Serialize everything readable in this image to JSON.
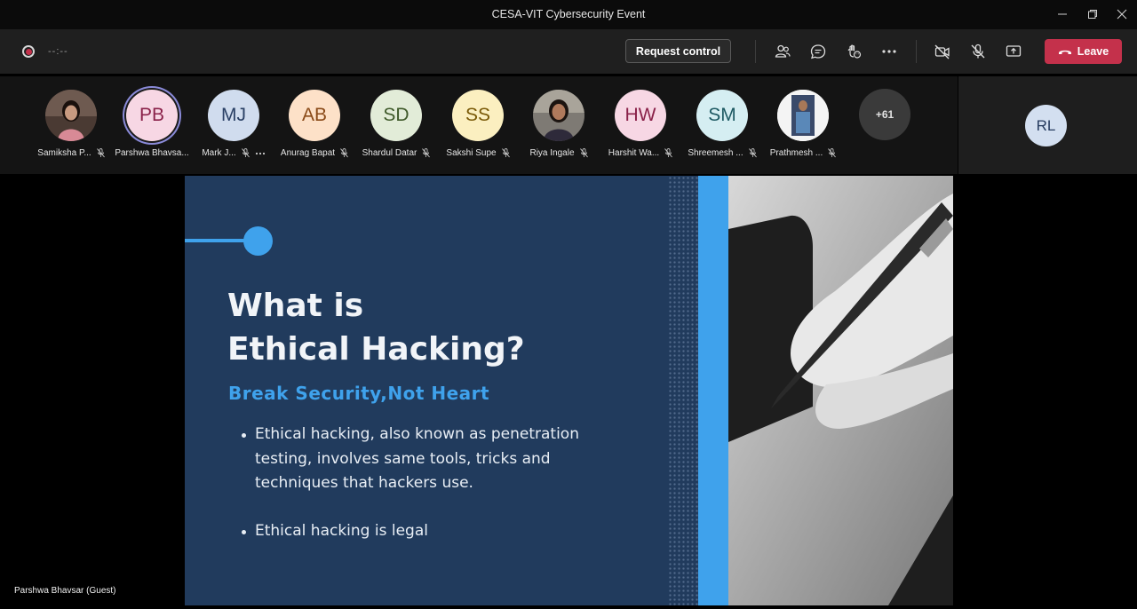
{
  "window": {
    "title": "CESA-VIT Cybersecurity Event"
  },
  "toolbar": {
    "timer": "--:--",
    "request_control_label": "Request control",
    "leave_label": "Leave",
    "colors": {
      "leave": "#c4314b",
      "recording": "#c4314b"
    }
  },
  "participants": [
    {
      "name": "Samiksha P...",
      "initials": "",
      "photo": true,
      "muted": true
    },
    {
      "name": "Parshwa Bhavsa...",
      "initials": "PB",
      "bg": "#f7d7e4",
      "fg": "#8a2149",
      "muted": false,
      "active": true
    },
    {
      "name": "Mark J...",
      "initials": "MJ",
      "bg": "#d0dcee",
      "fg": "#2b4166",
      "muted": true,
      "more": true
    },
    {
      "name": "Anurag Bapat",
      "initials": "AB",
      "bg": "#fde1c8",
      "fg": "#8a4a18",
      "muted": true
    },
    {
      "name": "Shardul Datar",
      "initials": "SD",
      "bg": "#e2ecd8",
      "fg": "#3f5a2a",
      "muted": true
    },
    {
      "name": "Sakshi Supe",
      "initials": "SS",
      "bg": "#fbefc0",
      "fg": "#7a5a08",
      "muted": true
    },
    {
      "name": "Riya Ingale",
      "initials": "",
      "photo": true,
      "muted": true
    },
    {
      "name": "Harshit Wa...",
      "initials": "HW",
      "bg": "#f7d7e4",
      "fg": "#8a2149",
      "muted": true
    },
    {
      "name": "Shreemesh ...",
      "initials": "SM",
      "bg": "#d5eef2",
      "fg": "#1e5a63",
      "muted": true
    },
    {
      "name": "Prathmesh ...",
      "initials": "",
      "photo": true,
      "muted": true
    }
  ],
  "overflow_count": "+61",
  "self_avatar": {
    "initials": "RL"
  },
  "slide": {
    "heading_line1": "What is",
    "heading_line2": "Ethical Hacking?",
    "subheading": "Break Security,Not Heart",
    "bullets": [
      "Ethical hacking, also known as penetration testing, involves same tools, tricks and techniques that hackers use.",
      "Ethical hacking is legal"
    ],
    "accent_color": "#3fa2ec",
    "bg_color": "#213b5d"
  },
  "speaker_label": "Parshwa Bhavsar (Guest)"
}
